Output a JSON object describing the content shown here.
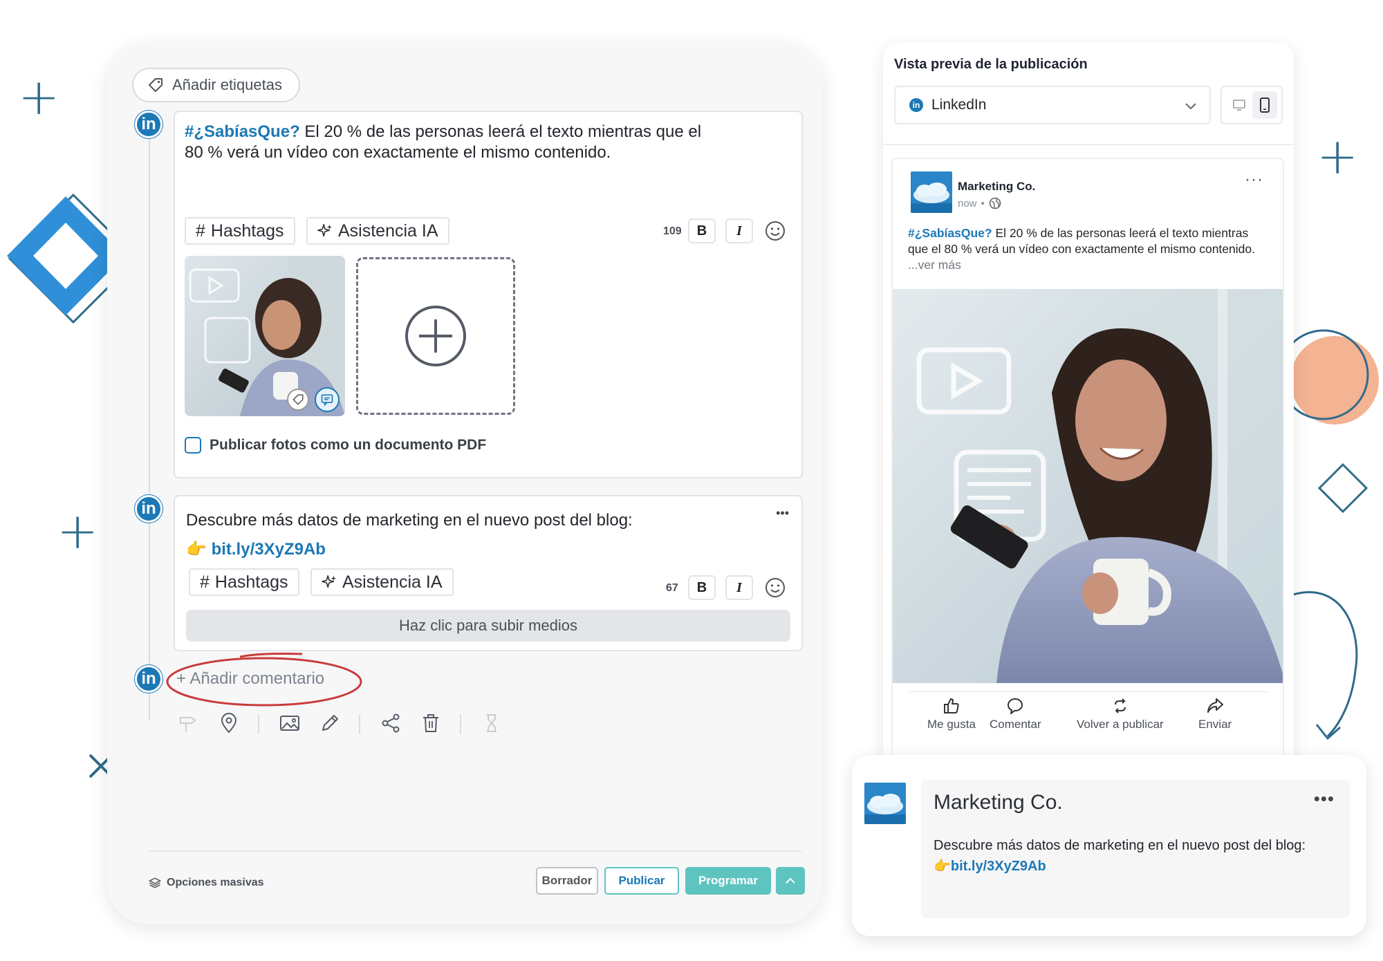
{
  "editor": {
    "tags_label": "Añadir etiquetas",
    "post1": {
      "hashtag": "#¿SabíasQue?",
      "text_line1": " El 20 % de las personas leerá el texto mientras que el",
      "text_line2": "80 % verá un vídeo con exactamente el mismo contenido.",
      "hashtags_label": "Hashtags",
      "ai_label": "Asistencia IA",
      "char_count": "109",
      "bold_label": "B",
      "italic_label": "I",
      "pdf_checkbox_label": "Publicar fotos como un documento PDF"
    },
    "post2": {
      "text_line1": "Descubre más datos de marketing en el nuevo post del blog:",
      "emoji": "👉",
      "link": "bit.ly/3XyZ9Ab",
      "more_label": "•••",
      "hashtags_label": "Hashtags",
      "ai_label": "Asistencia IA",
      "char_count": "67",
      "bold_label": "B",
      "italic_label": "I",
      "upload_label": "Haz clic para subir medios"
    },
    "add_comment_label": "+ Añadir comentario",
    "bulk_options_label": "Opciones masivas",
    "buttons": {
      "draft": "Borrador",
      "publish": "Publicar",
      "schedule": "Programar"
    },
    "li_badge": "in"
  },
  "preview": {
    "title": "Vista previa de la publicación",
    "network": "LinkedIn",
    "post": {
      "company": "Marketing Co.",
      "time": "now",
      "time_sep": "•",
      "dots": "···",
      "hashtag": "#¿SabíasQue?",
      "text": " El 20 % de las personas leerá el texto mientras que el 80 % verá un vídeo con exactamente el mismo contenido.",
      "see_more": " ...ver más"
    },
    "actions": [
      {
        "label": "Me gusta"
      },
      {
        "label": "Comentar"
      },
      {
        "label": "Volver a publicar"
      },
      {
        "label": "Enviar"
      }
    ]
  },
  "comment": {
    "company": "Marketing Co.",
    "dots": "•••",
    "text_line1": "Descubre más datos de marketing en el nuevo post del blog:",
    "emoji": "👉",
    "link": "bit.ly/3XyZ9Ab"
  },
  "colors": {
    "linkedin_blue": "#1c78b6",
    "schedule_teal": "#5ec4c0",
    "deco_blue": "#2f8fd8",
    "deco_salmon": "#f4b393",
    "deco_teal": "#2f6b8c",
    "comment_circle": "#c93b3b"
  }
}
